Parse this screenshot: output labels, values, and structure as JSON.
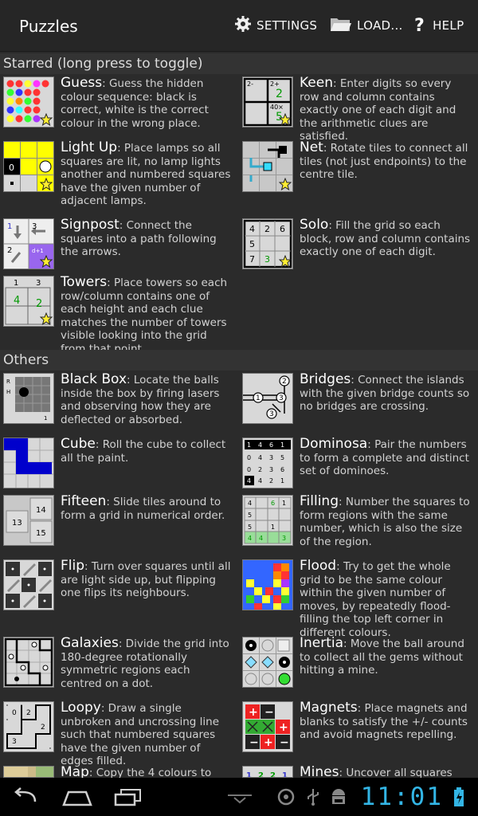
{
  "app": {
    "title": "Puzzles"
  },
  "actions": {
    "settings": "SETTINGS",
    "load": "LOAD...",
    "help": "HELP"
  },
  "sections": {
    "starred": "Starred (long press to toggle)",
    "others": "Others"
  },
  "starred": [
    {
      "name": "Guess",
      "desc": ": Guess the hidden colour sequence: black is correct, white is the correct colour in the wrong place.",
      "icon": "guess-thumbnail"
    },
    {
      "name": "Keen",
      "desc": ": Enter digits so every row and column contains exactly one of each digit and the arithmetic clues are satisfied.",
      "icon": "keen-thumbnail"
    },
    {
      "name": "Light Up",
      "desc": ": Place lamps so all squares are lit, no lamp lights another and numbered squares have the given number of adjacent lamps.",
      "icon": "lightup-thumbnail"
    },
    {
      "name": "Net",
      "desc": ": Rotate tiles to connect all tiles (not just endpoints) to the centre tile.",
      "icon": "net-thumbnail"
    },
    {
      "name": "Signpost",
      "desc": ": Connect the squares into a path following the arrows.",
      "icon": "signpost-thumbnail"
    },
    {
      "name": "Solo",
      "desc": ": Fill the grid so each block, row and column contains exactly one of each digit.",
      "icon": "solo-thumbnail"
    },
    {
      "name": "Towers",
      "desc": ": Place towers so each row/column contains one of each height and each clue matches the number of towers visible looking into the grid from that point.",
      "icon": "towers-thumbnail"
    }
  ],
  "others": [
    {
      "name": "Black Box",
      "desc": ": Locate the balls inside the box by firing lasers and observing how they are deflected or absorbed.",
      "icon": "blackbox-thumbnail"
    },
    {
      "name": "Bridges",
      "desc": ": Connect the islands with the given bridge counts so no bridges are crossing.",
      "icon": "bridges-thumbnail"
    },
    {
      "name": "Cube",
      "desc": ": Roll the cube to collect all the paint.",
      "icon": "cube-thumbnail"
    },
    {
      "name": "Dominosa",
      "desc": ": Pair the numbers to form a complete and distinct set of dominoes.",
      "icon": "dominosa-thumbnail"
    },
    {
      "name": "Fifteen",
      "desc": ": Slide tiles around to form a grid in numerical order.",
      "icon": "fifteen-thumbnail"
    },
    {
      "name": "Filling",
      "desc": ": Number the squares to form regions with the same number, which is also the size of the region.",
      "icon": "filling-thumbnail"
    },
    {
      "name": "Flip",
      "desc": ": Turn over squares until all are light side up, but flipping one flips its neighbours.",
      "icon": "flip-thumbnail"
    },
    {
      "name": "Flood",
      "desc": ": Try to get the whole grid to be the same colour within the given number of moves, by repeatedly flood-filling the top left corner in different colours.",
      "icon": "flood-thumbnail"
    },
    {
      "name": "Galaxies",
      "desc": ": Divide the grid into 180-degree rotationally symmetric regions each centred on a dot.",
      "icon": "galaxies-thumbnail"
    },
    {
      "name": "Inertia",
      "desc": ": Move the ball around to collect all the gems without hitting a mine.",
      "icon": "inertia-thumbnail"
    },
    {
      "name": "Loopy",
      "desc": ": Draw a single unbroken and uncrossing line such that numbered squares have the given number of edges filled.",
      "icon": "loopy-thumbnail"
    },
    {
      "name": "Magnets",
      "desc": ": Place magnets and blanks to satisfy the +/- counts and avoid magnets repelling.",
      "icon": "magnets-thumbnail"
    },
    {
      "name": "Map",
      "desc": ": Copy the 4 colours to",
      "icon": "map-thumbnail"
    },
    {
      "name": "Mines",
      "desc": ": Uncover all squares",
      "icon": "mines-thumbnail"
    }
  ],
  "thumb_text": {
    "keen": [
      "2-",
      "2+",
      "2",
      "40×",
      "5"
    ],
    "lightup": [
      "0"
    ],
    "signpost": [
      "1",
      "3",
      "2",
      "d+1"
    ],
    "solo": [
      "4",
      "2",
      "6",
      "5",
      "7",
      "3"
    ],
    "towers": [
      "1",
      "3",
      "4",
      "2"
    ],
    "blackbox": [
      "R",
      "H",
      "1"
    ],
    "bridges": [
      "2",
      "1",
      "3",
      "3"
    ],
    "dominosa": [
      "1",
      "4",
      "6",
      "1",
      "0",
      "4",
      "3",
      "5",
      "0",
      "2",
      "3",
      "6",
      "4",
      "4",
      "2",
      "1"
    ],
    "fifteen": [
      "14",
      "13",
      "15"
    ],
    "filling": [
      "4",
      "6",
      "1",
      "5",
      "1",
      "5",
      "4",
      "4",
      "3"
    ],
    "loopy": [
      "0",
      "2",
      "2",
      "3"
    ],
    "mines": [
      "1",
      "2",
      "2",
      "1"
    ]
  },
  "status": {
    "clock": "11:01"
  },
  "colors": {
    "accent": "#33b5e5",
    "star": "#ffee33"
  }
}
